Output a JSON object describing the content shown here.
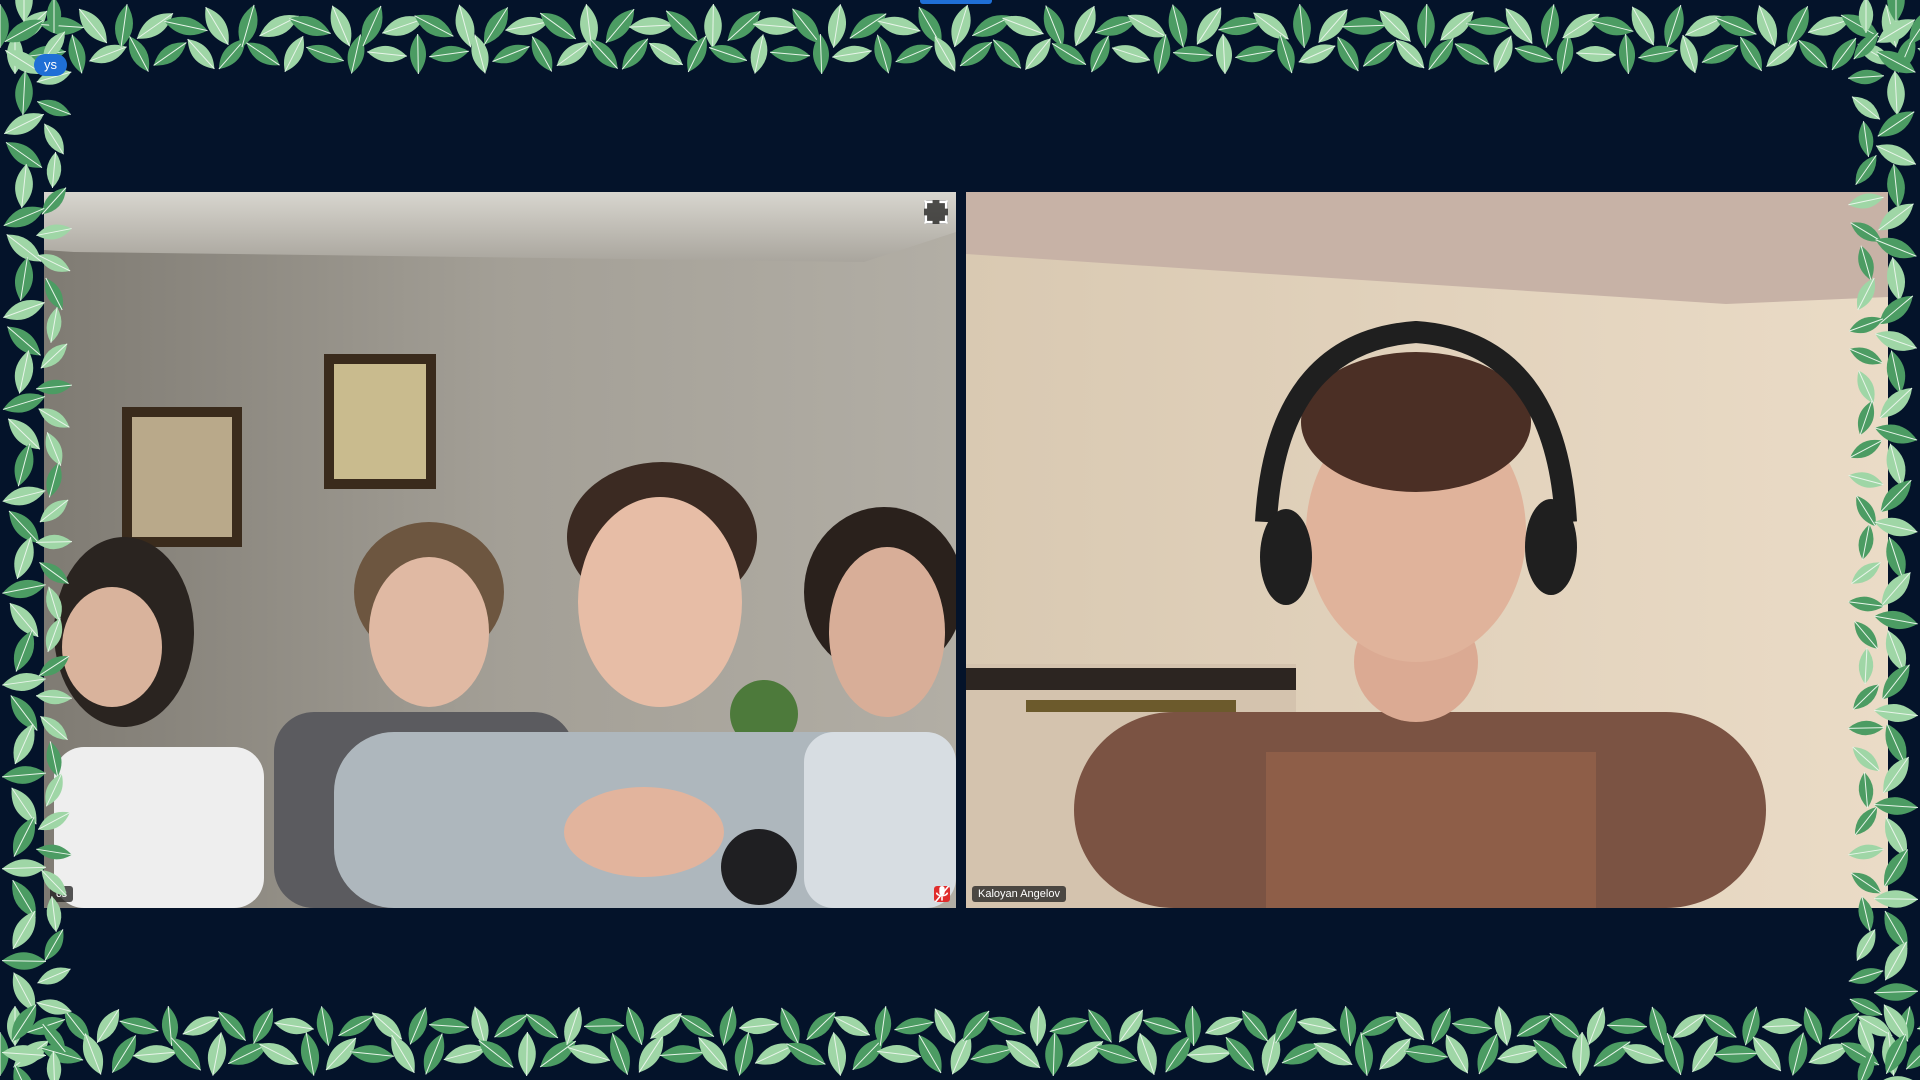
{
  "app": {
    "view_button_label": "ys"
  },
  "tiles": [
    {
      "participant_name": "cs",
      "muted": true
    },
    {
      "participant_name": "Kaloyan Angelov",
      "muted": false
    }
  ],
  "icons": {
    "expand": "expand-icon",
    "mute": "microphone-muted-icon"
  },
  "colors": {
    "background": "#04132a",
    "accent": "#1f6fd6",
    "muted_red": "#e02c2c",
    "leaf_light": "#9fd6a6",
    "leaf_dark": "#4c9c63"
  }
}
